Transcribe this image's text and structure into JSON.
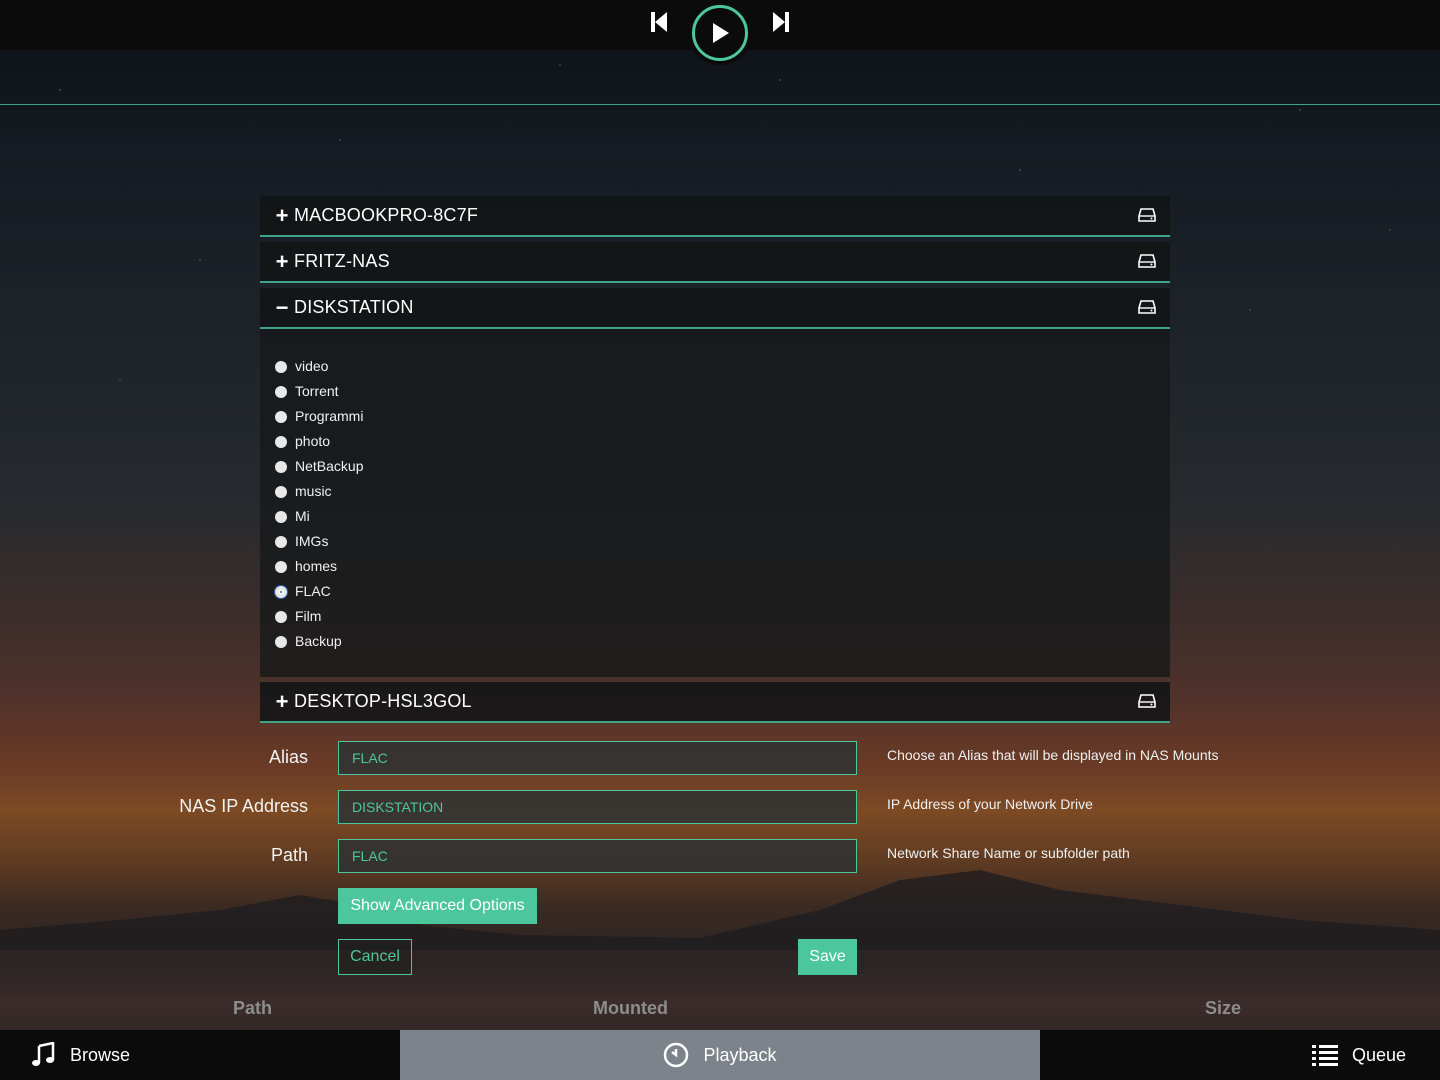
{
  "player": {
    "prev_icon": "skip-previous-icon",
    "play_icon": "play-icon",
    "next_icon": "skip-next-icon"
  },
  "nas_list": [
    {
      "name": "MACBOOKPRO-8C7F",
      "toggle": "+",
      "expanded": false
    },
    {
      "name": "FRITZ-NAS",
      "toggle": "+",
      "expanded": false
    },
    {
      "name": "DISKSTATION",
      "toggle": "−",
      "expanded": true
    },
    {
      "name": "DESKTOP-HSL3GOL",
      "toggle": "+",
      "expanded": false
    }
  ],
  "shares": [
    {
      "label": "video",
      "checked": false
    },
    {
      "label": "Torrent",
      "checked": false
    },
    {
      "label": "Programmi",
      "checked": false
    },
    {
      "label": "photo",
      "checked": false
    },
    {
      "label": "NetBackup",
      "checked": false
    },
    {
      "label": "music",
      "checked": false
    },
    {
      "label": "Mi",
      "checked": false
    },
    {
      "label": "IMGs",
      "checked": false
    },
    {
      "label": "homes",
      "checked": false
    },
    {
      "label": "FLAC",
      "checked": true
    },
    {
      "label": "Film",
      "checked": false
    },
    {
      "label": "Backup",
      "checked": false
    }
  ],
  "form": {
    "alias": {
      "label": "Alias",
      "value": "FLAC",
      "help": "Choose an Alias that will be displayed in NAS Mounts"
    },
    "ip": {
      "label": "NAS IP Address",
      "value": "DISKSTATION",
      "help": "IP Address of your Network Drive"
    },
    "path": {
      "label": "Path",
      "value": "FLAC",
      "help": "Network Share Name or subfolder path"
    },
    "advanced_label": "Show Advanced Options",
    "cancel_label": "Cancel",
    "save_label": "Save"
  },
  "table_header": {
    "path": "Path",
    "mounted": "Mounted",
    "size": "Size"
  },
  "bottom_nav": {
    "browse": "Browse",
    "playback": "Playback",
    "queue": "Queue"
  },
  "colors": {
    "accent": "#4cc69c",
    "bar": "#0b0b0b",
    "active_tab": "#7c838a"
  }
}
